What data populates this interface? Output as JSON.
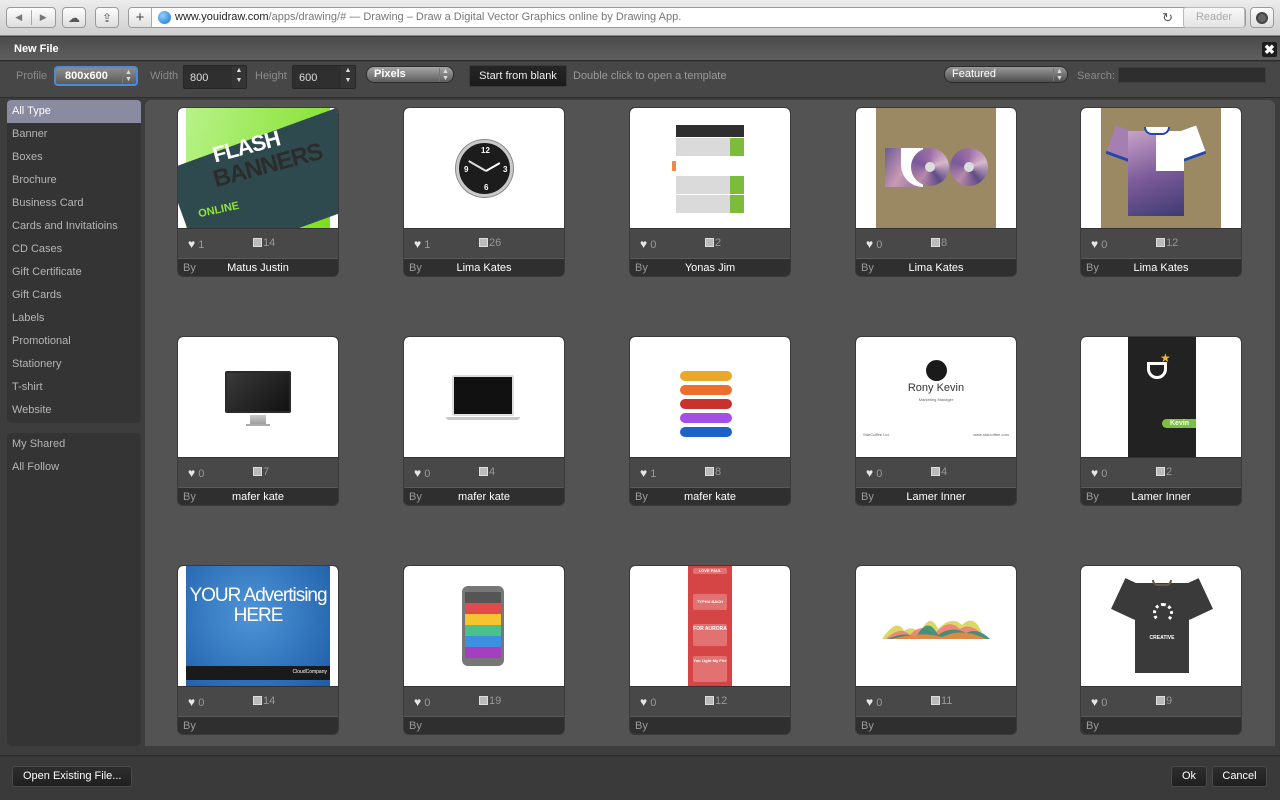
{
  "browser": {
    "url_domain": "www.youidraw.com",
    "url_path": "/apps/drawing/#",
    "page_title": " — Drawing – Draw a Digital Vector Graphics online by Drawing App.",
    "reader_label": "Reader"
  },
  "dialog": {
    "title": "New File",
    "close_label": "✖"
  },
  "toolbar": {
    "profile_label": "Profile",
    "profile_value": "800x600",
    "width_label": "Width",
    "width_value": "800",
    "height_label": "Height",
    "height_value": "600",
    "units_value": "Pixels",
    "start_blank_label": "Start from blank",
    "hint": "Double click to open a template",
    "sort_value": "Featured",
    "search_label": "Search:",
    "search_value": ""
  },
  "sidebar": {
    "categories": [
      {
        "label": "All Type",
        "active": true
      },
      {
        "label": "Banner"
      },
      {
        "label": "Boxes"
      },
      {
        "label": "Brochure"
      },
      {
        "label": "Business Card"
      },
      {
        "label": "Cards and Invitatioins"
      },
      {
        "label": "CD Cases"
      },
      {
        "label": "Gift Certificate"
      },
      {
        "label": "Gift Cards"
      },
      {
        "label": "Labels"
      },
      {
        "label": "Promotional"
      },
      {
        "label": "Stationery"
      },
      {
        "label": "T-shirt"
      },
      {
        "label": "Website"
      }
    ],
    "personal": [
      {
        "label": "My Shared"
      },
      {
        "label": "All Follow"
      }
    ]
  },
  "templates": [
    {
      "thumb": "flash-banners",
      "likes": "1",
      "edits": "14",
      "by": "By",
      "author": "Matus Justin",
      "flash_t1": "FLASH",
      "flash_t2": "BANNERS",
      "flash_t3": "ONLINE"
    },
    {
      "thumb": "wall-clock",
      "likes": "1",
      "edits": "26",
      "by": "By",
      "author": "Lima Kates"
    },
    {
      "thumb": "timeline-infographic",
      "likes": "0",
      "edits": "2",
      "by": "By",
      "author": "Yonas Jim"
    },
    {
      "thumb": "cd-case",
      "likes": "0",
      "edits": "8",
      "by": "By",
      "author": "Lima Kates"
    },
    {
      "thumb": "polygon-tshirt",
      "likes": "0",
      "edits": "12",
      "by": "By",
      "author": "Lima Kates"
    },
    {
      "thumb": "desktop-monitor",
      "likes": "0",
      "edits": "7",
      "by": "By",
      "author": "mafer kate"
    },
    {
      "thumb": "laptop",
      "likes": "0",
      "edits": "4",
      "by": "By",
      "author": "mafer kate"
    },
    {
      "thumb": "snake-infographic",
      "likes": "1",
      "edits": "8",
      "by": "By",
      "author": "mafer kate"
    },
    {
      "thumb": "business-card",
      "likes": "0",
      "edits": "4",
      "by": "By",
      "author": "Lamer Inner",
      "card_name": "Rony Kevin",
      "card_title": "Marketing Manager",
      "card_company": "StarCoffee Ltd.",
      "card_site": "www.starcoffee.com"
    },
    {
      "thumb": "business-card-vertical",
      "likes": "0",
      "edits": "2",
      "by": "By",
      "author": "Lamer Inner",
      "card_name": "Kevin"
    },
    {
      "thumb": "advertising-banner",
      "likes": "0",
      "edits": "14",
      "by": "By",
      "author": "",
      "ad_text": "YOUR Advertising HERE",
      "ad_logo": "CloudCompany"
    },
    {
      "thumb": "mobile-phone",
      "likes": "0",
      "edits": "19",
      "by": "By",
      "author": ""
    },
    {
      "thumb": "red-poster",
      "likes": "0",
      "edits": "12",
      "by": "By",
      "author": "",
      "poster_lines": [
        "LOVE PAUL",
        "TYPHA BACH",
        "FOR AURORA",
        "You Light My Fire"
      ]
    },
    {
      "thumb": "wave-chart",
      "likes": "0",
      "edits": "11",
      "by": "By",
      "author": ""
    },
    {
      "thumb": "creative-tshirt",
      "likes": "0",
      "edits": "9",
      "by": "By",
      "author": "",
      "shirt_text": "CREATIVE"
    }
  ],
  "footer": {
    "open_existing_label": "Open Existing File...",
    "ok_label": "Ok",
    "cancel_label": "Cancel"
  },
  "colors": {
    "active_category": "#8a8aa0",
    "focus_ring": "#4f8ad8"
  }
}
